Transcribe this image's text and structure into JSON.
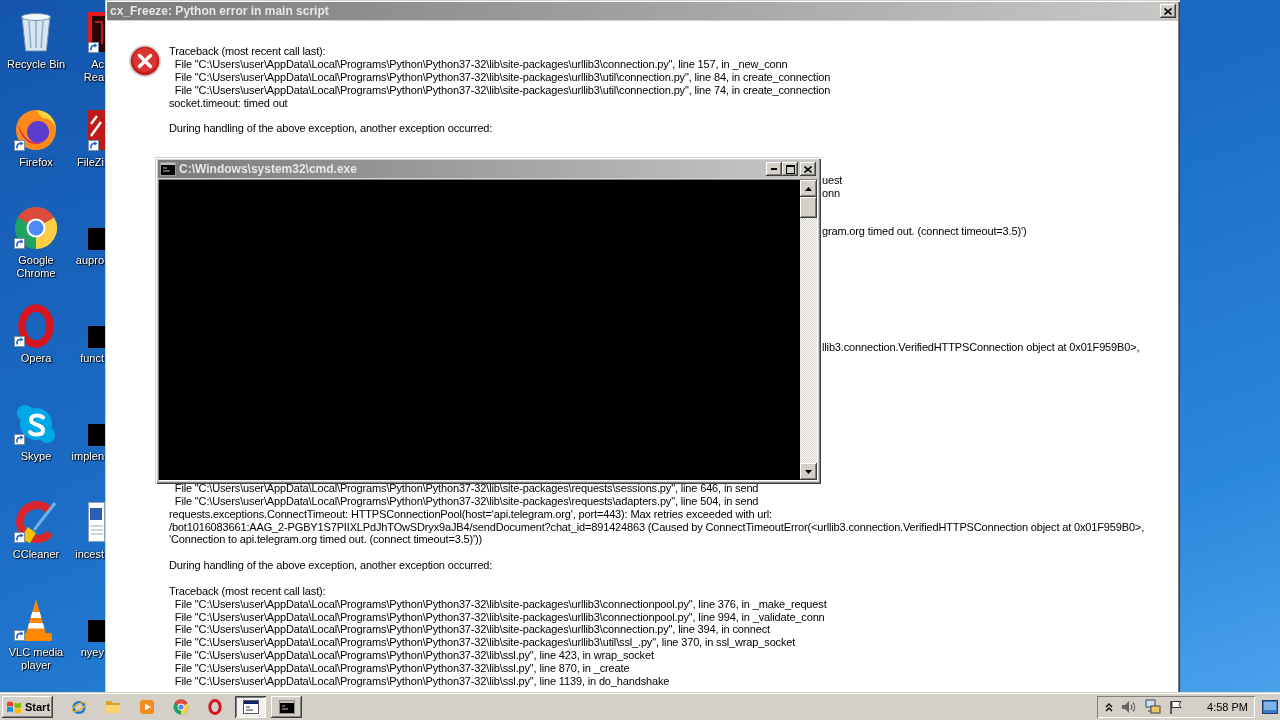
{
  "desktop": {
    "icons": [
      {
        "kind": "bin",
        "label": "Recycle Bin",
        "shortcut": false
      },
      {
        "kind": "fox",
        "label": "Firefox",
        "shortcut": true
      },
      {
        "kind": "wheel",
        "label": "Google Chrome",
        "shortcut": true
      },
      {
        "kind": "ring",
        "label": "Opera",
        "shortcut": true
      },
      {
        "kind": "cloud",
        "label": "Skype",
        "shortcut": true
      },
      {
        "kind": "brush",
        "label": "CCleaner",
        "shortcut": true
      },
      {
        "kind": "cone",
        "label": "VLC media player",
        "shortcut": true
      }
    ],
    "icons_column_2": [
      {
        "kind": "reader",
        "label": "Ac Rea",
        "shortcut": true
      },
      {
        "kind": "tile",
        "label": "FileZi",
        "shortcut": true
      },
      {
        "kind": "blackfile",
        "label": "aupro",
        "shortcut": false
      },
      {
        "kind": "blackfile",
        "label": "funct",
        "shortcut": false
      },
      {
        "kind": "blackfile",
        "label": "implen",
        "shortcut": false
      },
      {
        "kind": "document",
        "label": "incest",
        "shortcut": false
      },
      {
        "kind": "blackfile",
        "label": "nyey",
        "shortcut": false
      }
    ]
  },
  "error_dialog": {
    "title": "cx_Freeze: Python error in main script",
    "lines": [
      {
        "kind": "text",
        "text": "Traceback (most recent call last):"
      },
      {
        "kind": "text",
        "text": "  File \"C:\\Users\\user\\AppData\\Local\\Programs\\Python\\Python37-32\\lib\\site-packages\\urllib3\\connection.py\", line 157, in _new_conn"
      },
      {
        "kind": "text",
        "text": "  File \"C:\\Users\\user\\AppData\\Local\\Programs\\Python\\Python37-32\\lib\\site-packages\\urllib3\\util\\connection.py\", line 84, in create_connection"
      },
      {
        "kind": "text",
        "text": "  File \"C:\\Users\\user\\AppData\\Local\\Programs\\Python\\Python37-32\\lib\\site-packages\\urllib3\\util\\connection.py\", line 74, in create_connection"
      },
      {
        "kind": "text",
        "text": "socket.timeout: timed out"
      },
      {
        "kind": "blank"
      },
      {
        "kind": "text",
        "text": "During handling of the above exception, another exception occurred:"
      },
      {
        "kind": "blank"
      },
      {
        "kind": "blank"
      },
      {
        "kind": "blank"
      },
      {
        "kind": "fragment",
        "text": "uest"
      },
      {
        "kind": "fragment",
        "text": "onn"
      },
      {
        "kind": "blank"
      },
      {
        "kind": "blank"
      },
      {
        "kind": "fragment",
        "text": "gram.org timed out. (connect timeout=3.5)')"
      },
      {
        "kind": "blank"
      },
      {
        "kind": "blank"
      },
      {
        "kind": "blank"
      },
      {
        "kind": "blank"
      },
      {
        "kind": "blank"
      },
      {
        "kind": "blank"
      },
      {
        "kind": "blank"
      },
      {
        "kind": "blank"
      },
      {
        "kind": "fragment",
        "text": "llib3.connection.VerifiedHTTPSConnection object at 0x01F959B0>,"
      },
      {
        "kind": "blank"
      },
      {
        "kind": "blank"
      },
      {
        "kind": "blank"
      },
      {
        "kind": "blank"
      },
      {
        "kind": "blank"
      },
      {
        "kind": "blank"
      },
      {
        "kind": "blank"
      },
      {
        "kind": "blank"
      },
      {
        "kind": "blank"
      },
      {
        "kind": "blank"
      },
      {
        "kind": "text",
        "text": "  File \"C:\\Users\\user\\AppData\\Local\\Programs\\Python\\Python37-32\\lib\\site-packages\\requests\\sessions.py\", line 646, in send"
      },
      {
        "kind": "text",
        "text": "  File \"C:\\Users\\user\\AppData\\Local\\Programs\\Python\\Python37-32\\lib\\site-packages\\requests\\adapters.py\", line 504, in send"
      },
      {
        "kind": "text",
        "text": "requests.exceptions.ConnectTimeout: HTTPSConnectionPool(host='api.telegram.org', port=443): Max retries exceeded with url:"
      },
      {
        "kind": "text",
        "text": "/bot1016083661:AAG_2-PGBY1S7PIIXLPdJhTOwSDryx9aJB4/sendDocument?chat_id=891424863 (Caused by ConnectTimeoutError(<urllib3.connection.VerifiedHTTPSConnection object at 0x01F959B0>,"
      },
      {
        "kind": "text",
        "text": "'Connection to api.telegram.org timed out. (connect timeout=3.5)'))"
      },
      {
        "kind": "blank"
      },
      {
        "kind": "text",
        "text": "During handling of the above exception, another exception occurred:"
      },
      {
        "kind": "blank"
      },
      {
        "kind": "text",
        "text": "Traceback (most recent call last):"
      },
      {
        "kind": "text",
        "text": "  File \"C:\\Users\\user\\AppData\\Local\\Programs\\Python\\Python37-32\\lib\\site-packages\\urllib3\\connectionpool.py\", line 376, in _make_request"
      },
      {
        "kind": "text",
        "text": "  File \"C:\\Users\\user\\AppData\\Local\\Programs\\Python\\Python37-32\\lib\\site-packages\\urllib3\\connectionpool.py\", line 994, in _validate_conn"
      },
      {
        "kind": "text",
        "text": "  File \"C:\\Users\\user\\AppData\\Local\\Programs\\Python\\Python37-32\\lib\\site-packages\\urllib3\\connection.py\", line 394, in connect"
      },
      {
        "kind": "text",
        "text": "  File \"C:\\Users\\user\\AppData\\Local\\Programs\\Python\\Python37-32\\lib\\site-packages\\urllib3\\util\\ssl_.py\", line 370, in ssl_wrap_socket"
      },
      {
        "kind": "text",
        "text": "  File \"C:\\Users\\user\\AppData\\Local\\Programs\\Python\\Python37-32\\lib\\ssl.py\", line 423, in wrap_socket"
      },
      {
        "kind": "text",
        "text": "  File \"C:\\Users\\user\\AppData\\Local\\Programs\\Python\\Python37-32\\lib\\ssl.py\", line 870, in _create"
      },
      {
        "kind": "text",
        "text": "  File \"C:\\Users\\user\\AppData\\Local\\Programs\\Python\\Python37-32\\lib\\ssl.py\", line 1139, in do_handshake"
      }
    ]
  },
  "console_window": {
    "title": "C:\\Windows\\system32\\cmd.exe"
  },
  "taskbar": {
    "start_label": "Start",
    "buttons": [
      {
        "kind": "window",
        "selected": true
      },
      {
        "kind": "console",
        "selected": false
      }
    ],
    "clock": "4:58 PM"
  }
}
